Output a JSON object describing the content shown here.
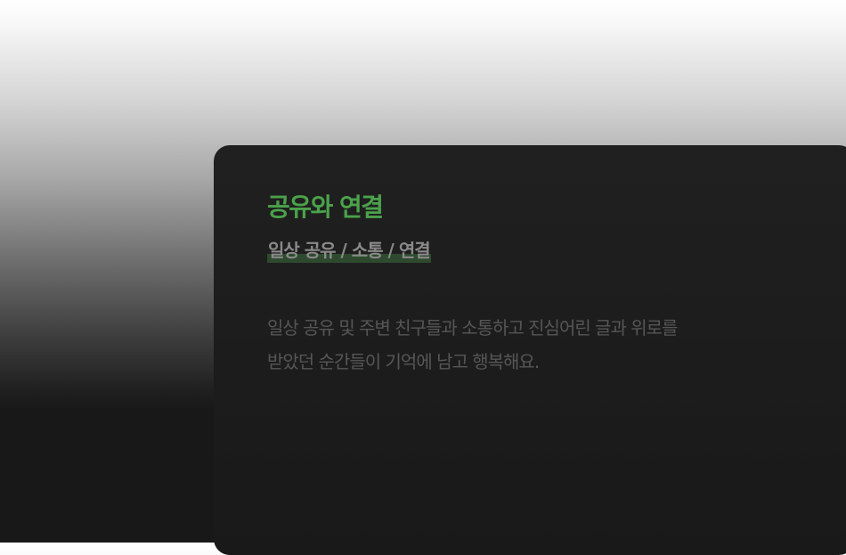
{
  "card": {
    "title": "공유와 연결",
    "subtitle": "일상 공유 / 소통 / 연결",
    "description_lines": [
      "일상 공유 및 주변 친구들과 소통하고 진심어린 글과 위로를",
      "받았던 순간들이 기억에 남고 행복해요."
    ]
  },
  "colors": {
    "title_accent": "#4aa24a",
    "subtitle_highlight": "#2e4a2e",
    "card_background": "#1e1e1e"
  }
}
